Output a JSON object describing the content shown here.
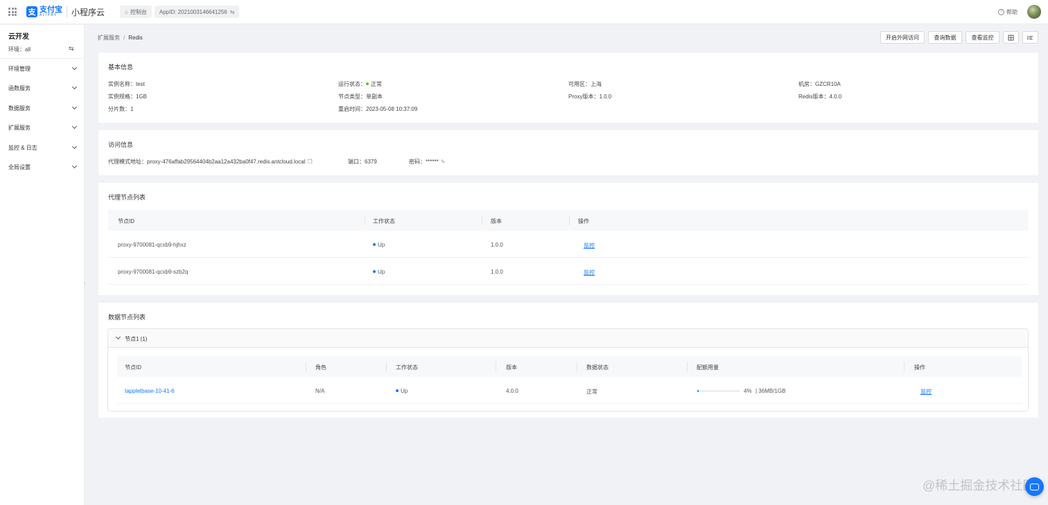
{
  "topbar": {
    "logo_cn": "支付宝",
    "logo_en": "ALIPAY",
    "product": "小程序云",
    "console_label": "控制台",
    "appid_label": "AppID: 2021003146641256",
    "help_label": "帮助"
  },
  "sidebar": {
    "title": "云开发",
    "env_label": "环境：all",
    "items": [
      {
        "label": "环境管理"
      },
      {
        "label": "函数服务"
      },
      {
        "label": "数据服务"
      },
      {
        "label": "扩展服务"
      },
      {
        "label": "监控 & 日志"
      },
      {
        "label": "全局设置"
      }
    ]
  },
  "breadcrumb": {
    "parent": "扩展服务",
    "separator": "/",
    "current": "Redis"
  },
  "actions": {
    "public_access": "开启外网访问",
    "query_data": "查询数据",
    "view_monitor": "查看监控"
  },
  "basic": {
    "title": "基本信息",
    "instance_name": "实例名称：test",
    "run_status_label": "运行状态：",
    "run_status": "正常",
    "zone": "可用区：上海",
    "room": "机房：GZCR10A",
    "spec": "实例规格：1GB",
    "node_type": "节点类型：单副本",
    "proxy_version": "Proxy版本：1.0.0",
    "redis_version": "Redis版本：4.0.0",
    "shards": "分片数：1",
    "restart_time": "重启时间：2023-05-08 10:37:09"
  },
  "access": {
    "title": "访问信息",
    "proxy_addr": "代理模式地址：proxy-476affab29564404b2aa12a432ba0f47.redis.antcloud.local",
    "port": "端口：6379",
    "password": "密码：******"
  },
  "proxy_nodes": {
    "title": "代理节点列表",
    "columns": [
      "节点ID",
      "工作状态",
      "版本",
      "操作"
    ],
    "rows": [
      {
        "id": "proxy-9700081-qcxb9-hjhxz",
        "status": "Up",
        "version": "1.0.0",
        "action": "监控"
      },
      {
        "id": "proxy-9700081-qcxb9-szb2q",
        "status": "Up",
        "version": "1.0.0",
        "action": "监控"
      }
    ]
  },
  "data_nodes": {
    "title": "数据节点列表",
    "group_title": "节点1 (1)",
    "columns": [
      "节点ID",
      "角色",
      "工作状态",
      "版本",
      "数据状态",
      "配额用量",
      "操作"
    ],
    "rows": [
      {
        "id": "tappletbase-10-41-6",
        "role": "N/A",
        "status": "Up",
        "version": "4.0.0",
        "data_status": "正常",
        "quota_pct": 4,
        "quota_pct_label": "4%",
        "quota_usage": "| 36MB/1GB",
        "action": "监控"
      }
    ]
  },
  "watermark": "@稀土掘金技术社区",
  "colors": {
    "accent": "#1677ff",
    "status_ok": "#52c41a",
    "background": "#f0f2f5"
  },
  "icons": {
    "apps": "apps-grid-icon",
    "home": "home-icon",
    "switch": "switch-icon",
    "help": "help-circle-icon",
    "copy": "copy-icon",
    "edit": "edit-icon",
    "fullscreen": "fullscreen-icon",
    "menu": "menu-icon",
    "chat": "chat-icon"
  }
}
